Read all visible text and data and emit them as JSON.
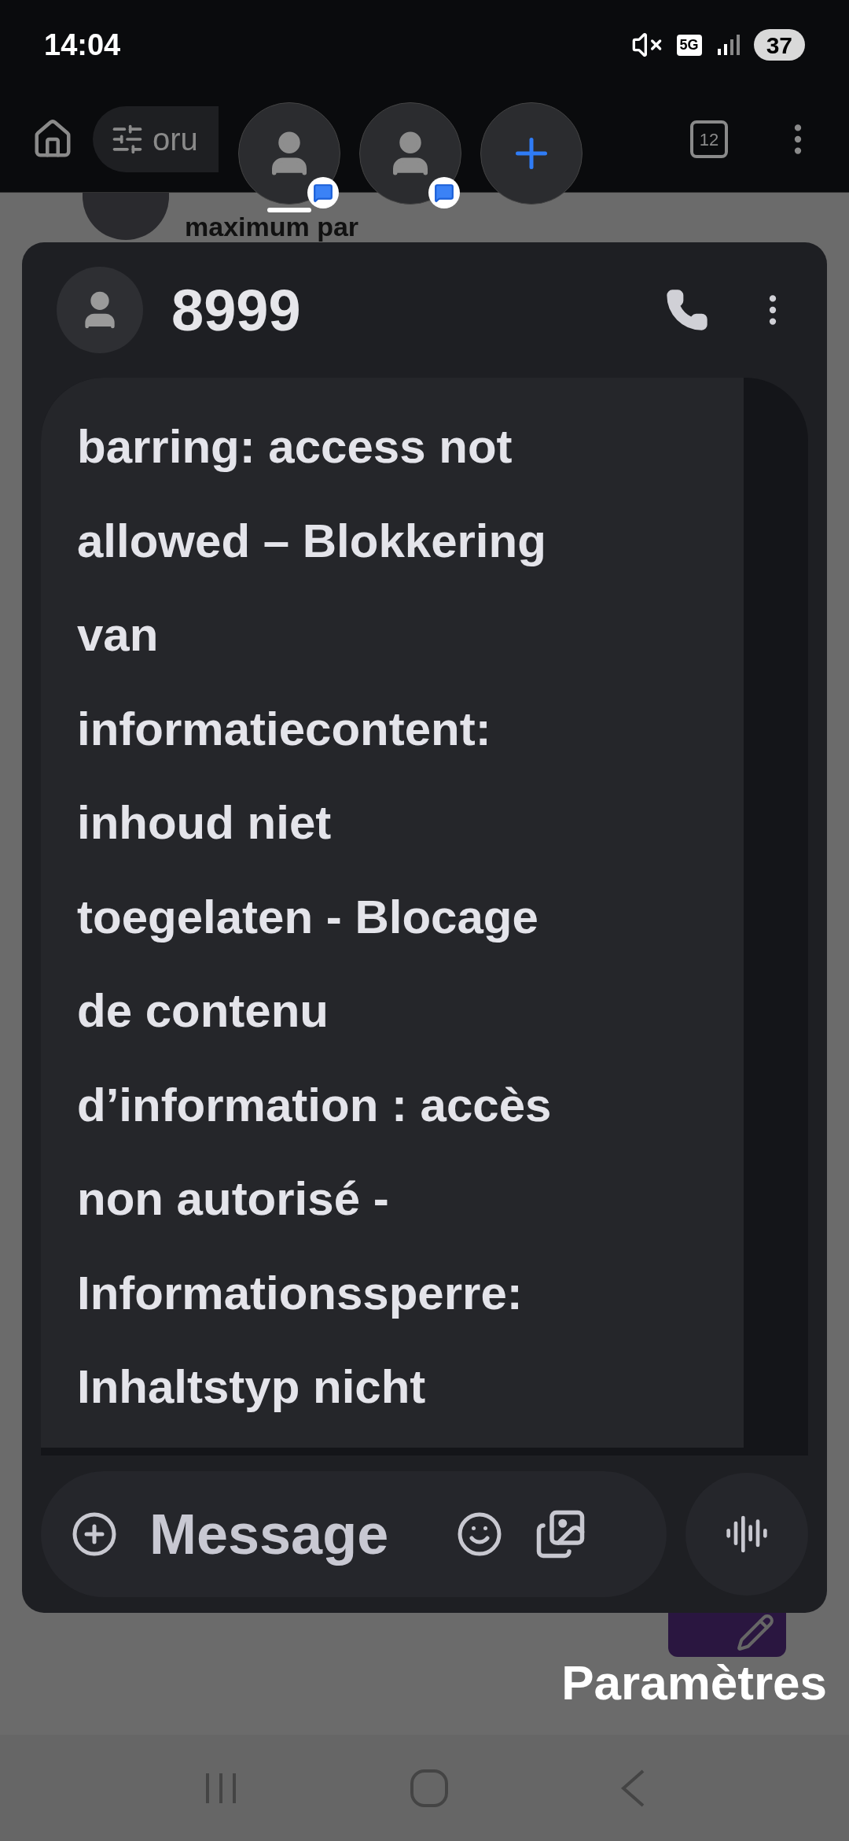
{
  "status_bar": {
    "time": "14:04",
    "network": "5G",
    "battery": "37"
  },
  "browser": {
    "address": "oru",
    "tab_count": "12"
  },
  "chat_heads": [
    {
      "kind": "contact",
      "selected": true,
      "unread": true
    },
    {
      "kind": "contact",
      "selected": false,
      "unread": true
    },
    {
      "kind": "add",
      "selected": false
    }
  ],
  "background_page": {
    "heading": "maximum par"
  },
  "conversation": {
    "title": "8999",
    "message": "barring: access not\nallowed – Blokkering\nvan\ninformatiecontent:\ninhoud niet\ntoegelaten - Blocage\nde contenu\nd’information : accès\nnon autorisé -\nInformationssperre:\nInhaltstyp nicht",
    "composer": {
      "placeholder": "Message"
    }
  },
  "fab_label": "Paramètres"
}
